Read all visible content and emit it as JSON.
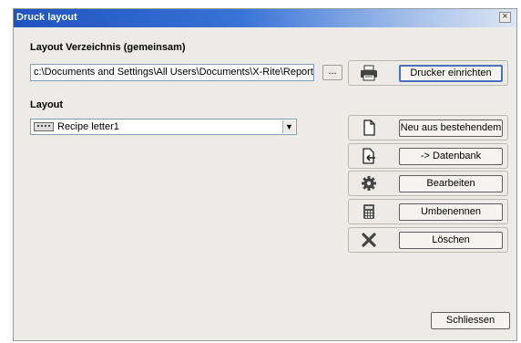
{
  "window": {
    "title": "Druck layout",
    "close_glyph": "×"
  },
  "directory": {
    "label": "Layout Verzeichnis (gemeinsam)",
    "path_value": "c:\\Documents and Settings\\All Users\\Documents\\X-Rite\\Reports\\",
    "browse_label": "..."
  },
  "layout": {
    "label": "Layout",
    "selected": "Recipe letter1",
    "dropdown_arrow": "▼"
  },
  "actions": [
    {
      "icon": "printer-icon",
      "label": "Drucker einrichten"
    },
    {
      "icon": "document-icon",
      "label": "Neu aus bestehendem"
    },
    {
      "icon": "document-export-icon",
      "label": "-> Datenbank"
    },
    {
      "icon": "gear-icon",
      "label": "Bearbeiten"
    },
    {
      "icon": "calculator-icon",
      "label": "Umbenennen"
    },
    {
      "icon": "delete-x-icon",
      "label": "Löschen"
    }
  ],
  "footer": {
    "close_label": "Schliessen"
  }
}
